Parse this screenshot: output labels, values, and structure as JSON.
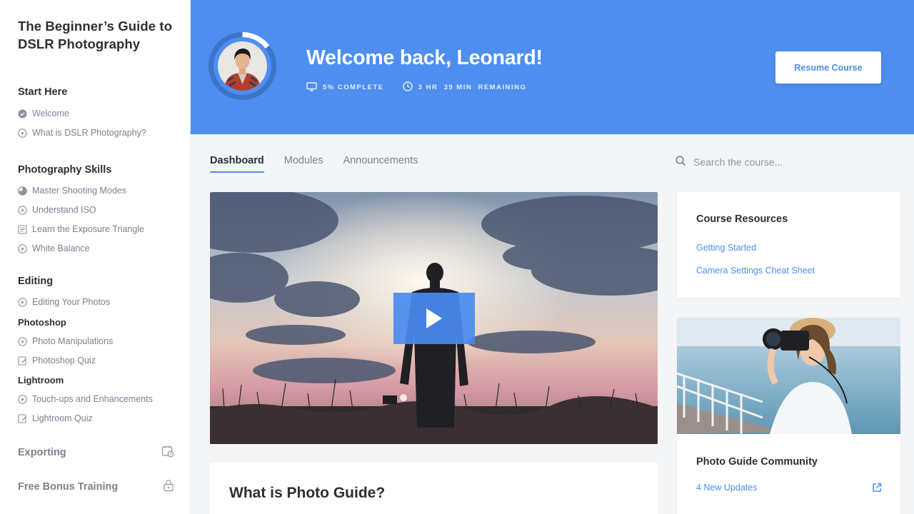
{
  "sidebar": {
    "course_title": "The Beginner’s Guide to DSLR Photography",
    "sections": [
      {
        "title": "Start Here",
        "lessons": [
          {
            "label": "Welcome",
            "icon": "check-circle-icon"
          },
          {
            "label": "What is DSLR Photography?",
            "icon": "play-circle-icon"
          }
        ]
      },
      {
        "title": "Photography Skills",
        "lessons": [
          {
            "label": "Master Shooting Modes",
            "icon": "half-circle-icon"
          },
          {
            "label": "Understand ISO",
            "icon": "play-circle-icon"
          },
          {
            "label": "Learn the Exposure Triangle",
            "icon": "document-icon"
          },
          {
            "label": "White Balance",
            "icon": "play-circle-icon"
          }
        ]
      },
      {
        "title": "Editing",
        "lessons": [
          {
            "label": "Editing Your Photos",
            "icon": "play-circle-icon"
          }
        ],
        "subsections": [
          {
            "title": "Photoshop",
            "lessons": [
              {
                "label": "Photo Manipulations",
                "icon": "play-circle-icon"
              },
              {
                "label": "Photoshop Quiz",
                "icon": "quiz-icon"
              }
            ]
          },
          {
            "title": "Lightroom",
            "lessons": [
              {
                "label": "Touch-ups and Enhancements",
                "icon": "play-circle-icon"
              },
              {
                "label": "Lightroom Quiz",
                "icon": "quiz-icon"
              }
            ]
          }
        ]
      }
    ],
    "locked_sections": [
      {
        "title": "Exporting",
        "icon": "calendar-clock-icon"
      },
      {
        "title": "Free Bonus Training",
        "icon": "lock-icon"
      }
    ]
  },
  "banner": {
    "welcome": "Welcome back, Leonard!",
    "progress_label": "5% COMPLETE",
    "progress": 0.05,
    "remaining_label": "3 HR  39 MIN  REMAINING",
    "resume_label": "Resume Course",
    "bg_color": "#4e8ef1"
  },
  "tabs": [
    "Dashboard",
    "Modules",
    "Announcements"
  ],
  "active_tab": "Dashboard",
  "search": {
    "placeholder": "Search the course..."
  },
  "about": {
    "title": "What is Photo Guide?"
  },
  "resources": {
    "title": "Course Resources",
    "links": [
      "Getting Started",
      "Camera Settings Cheat Sheet"
    ]
  },
  "community": {
    "title": "Photo Guide Community",
    "updates": "4 New Updates"
  },
  "colors": {
    "accent": "#4e8ef1",
    "text": "#2b2f36",
    "muted": "#7a828d"
  }
}
